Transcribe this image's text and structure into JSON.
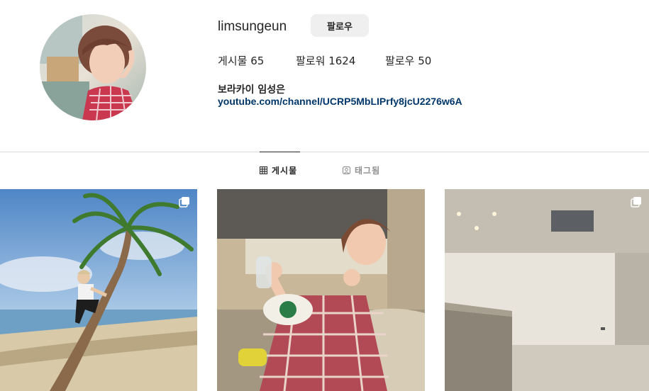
{
  "profile": {
    "username": "limsungeun",
    "follow_label": "팔로우",
    "stats": {
      "posts_label": "게시물",
      "posts_count": "65",
      "followers_label": "팔로워",
      "followers_count": "1624",
      "following_label": "팔로우",
      "following_count": "50"
    },
    "bio_name": "보라카이 임성은",
    "bio_link": "youtube.com/channel/UCRP5MbLIPrfy8jcU2276w6A"
  },
  "tabs": [
    {
      "label": "게시물",
      "icon": "grid-icon",
      "active": true
    },
    {
      "label": "태그됨",
      "icon": "tagged-icon",
      "active": false
    }
  ],
  "posts": [
    {
      "description_icon": "multi-post-icon",
      "has_multiple": true
    },
    {
      "has_multiple": false
    },
    {
      "description_icon": "multi-post-icon",
      "has_multiple": true
    }
  ],
  "colors": {
    "link": "#00376b",
    "button_bg": "#efefef",
    "divider": "#dbdbdb",
    "muted": "#8e8e8e"
  }
}
